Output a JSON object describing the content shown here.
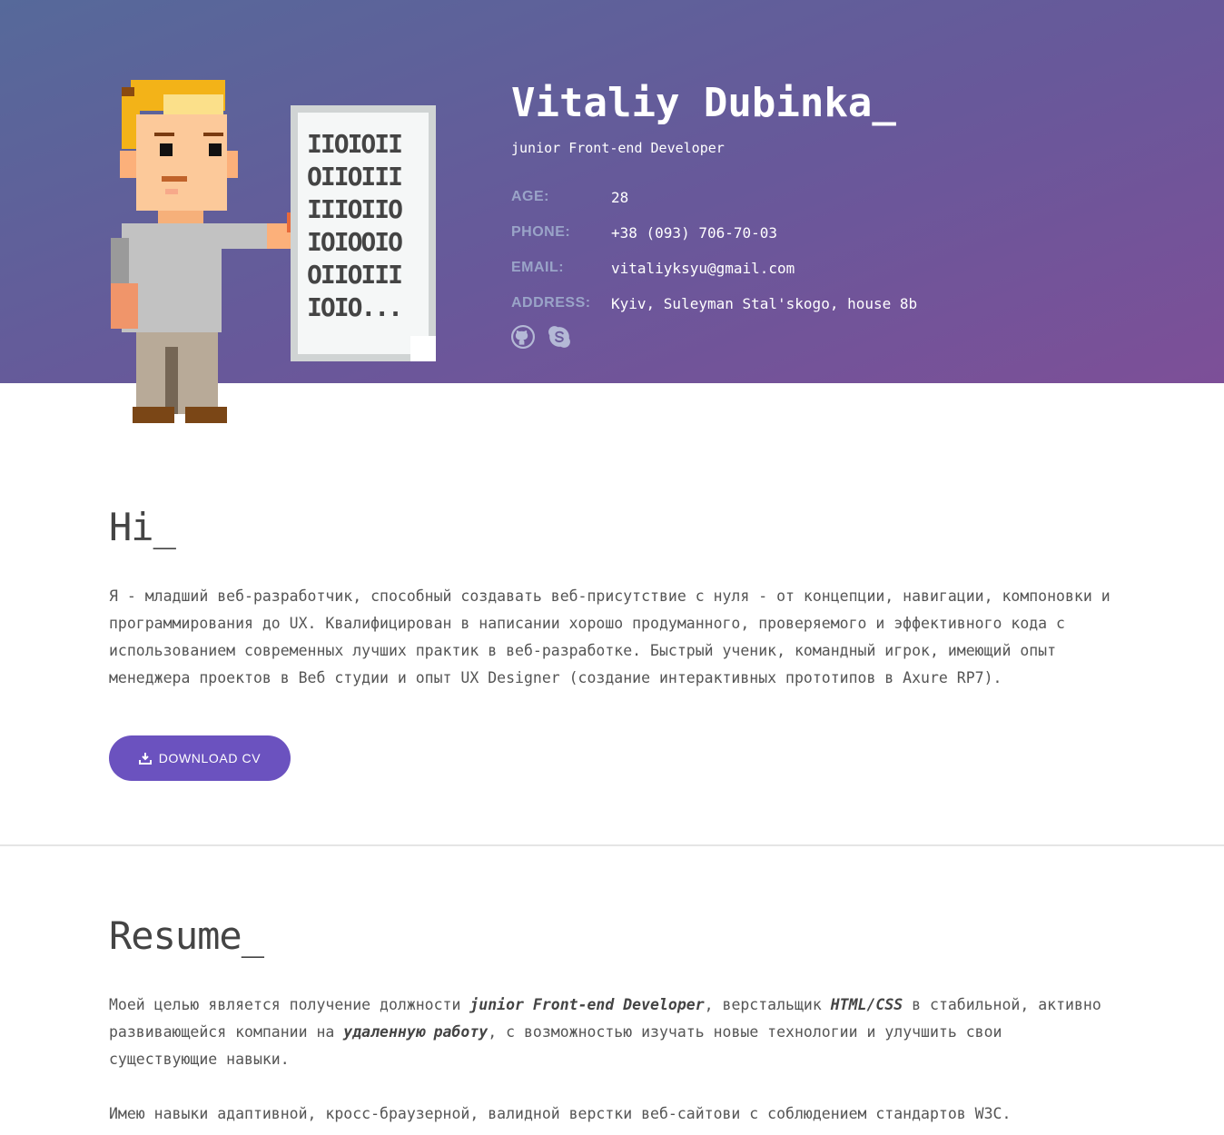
{
  "header": {
    "name": "Vitaliy Dubinka_",
    "role": "junior Front-end Developer",
    "details": [
      {
        "label": "AGE:",
        "value": "28"
      },
      {
        "label": "PHONE:",
        "value": "+38 (093) 706-70-03"
      },
      {
        "label": "EMAIL:",
        "value": "vitaliyksyu@gmail.com"
      },
      {
        "label": "ADDRESS:",
        "value": "Kyiv, Suleyman Stal'skogo, house 8b"
      }
    ],
    "socials": [
      "github-icon",
      "skype-icon"
    ],
    "document_text": [
      "IIOIOII",
      "OIIOIII",
      "IIIOIIO",
      "IOIOOIO",
      "OIIOIII",
      "IOIO..."
    ]
  },
  "hi": {
    "title": "Hi_",
    "text": "Я - младший веб-разработчик, способный создавать веб-присутствие с нуля - от концепции, навигации, компоновки и программирования до UX. Квалифицирован в написании хорошо продуманного, проверяемого и эффективного кода с использованием современных лучших практик в веб-разработке. Быстрый ученик, командный игрок, имеющий опыт менеджера проектов в Веб студии и опыт UX Designer (создание интерактивных прототипов в Axure RP7).",
    "button": "DOWNLOAD CV"
  },
  "resume": {
    "title": "Resume_",
    "p1": {
      "t1": "Моей целью является получение должности ",
      "b1": "junior Front-end Developer",
      "t2": ", верстальщик ",
      "b2": "HTML/CSS",
      "t3": " в стабильной, активно развивающейся компании на ",
      "b3": "удаленную работу",
      "t4": ", с возможностью изучать новые технологии и улучшить свои существующие навыки."
    },
    "p2": "Имею навыки адаптивной, кросс-браузерной, валидной верстки веб-сайтови с соблюдением стандартов W3C."
  },
  "colors": {
    "header_start": "#56699a",
    "header_end": "#7d4f98",
    "button": "#6b52bf",
    "label": "#9aa4c8"
  }
}
